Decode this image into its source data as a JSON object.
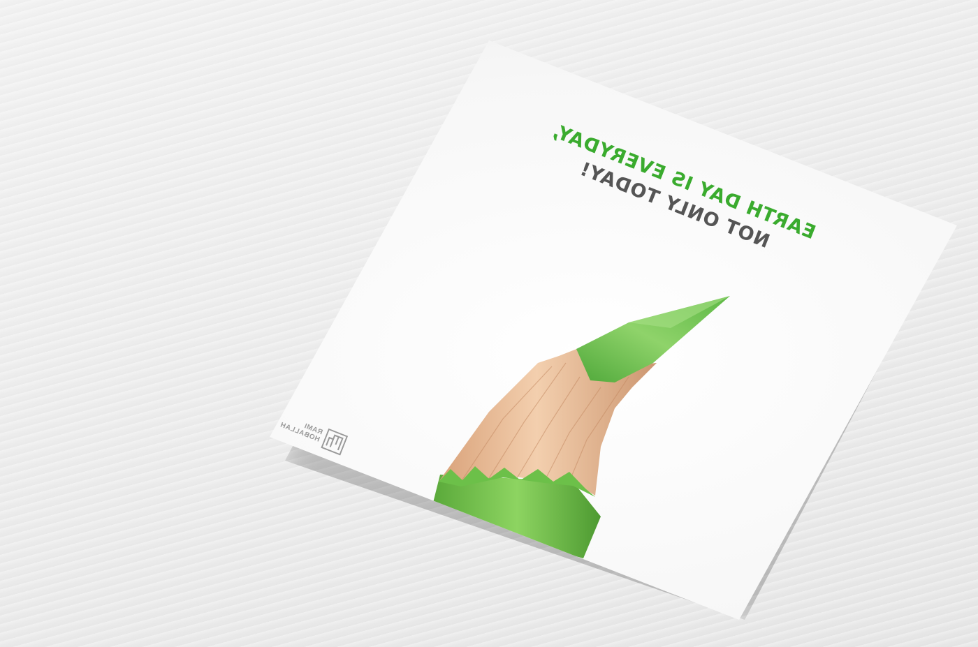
{
  "card": {
    "headline_line1": "EARTH DAY IS EVERYDAY,",
    "headline_line2": "NOT ONLY TODAY!",
    "headline_color": "#3aab2e",
    "subline_color": "#555555",
    "image_subject": "green-pencil-tip",
    "logo": {
      "first_name": "RAMI",
      "last_name": "HOBALLAH"
    }
  },
  "colors": {
    "background": "#ececec",
    "pencil_green": "#6cc049",
    "pencil_lead": "#79c754",
    "wood": "#e9b997"
  }
}
